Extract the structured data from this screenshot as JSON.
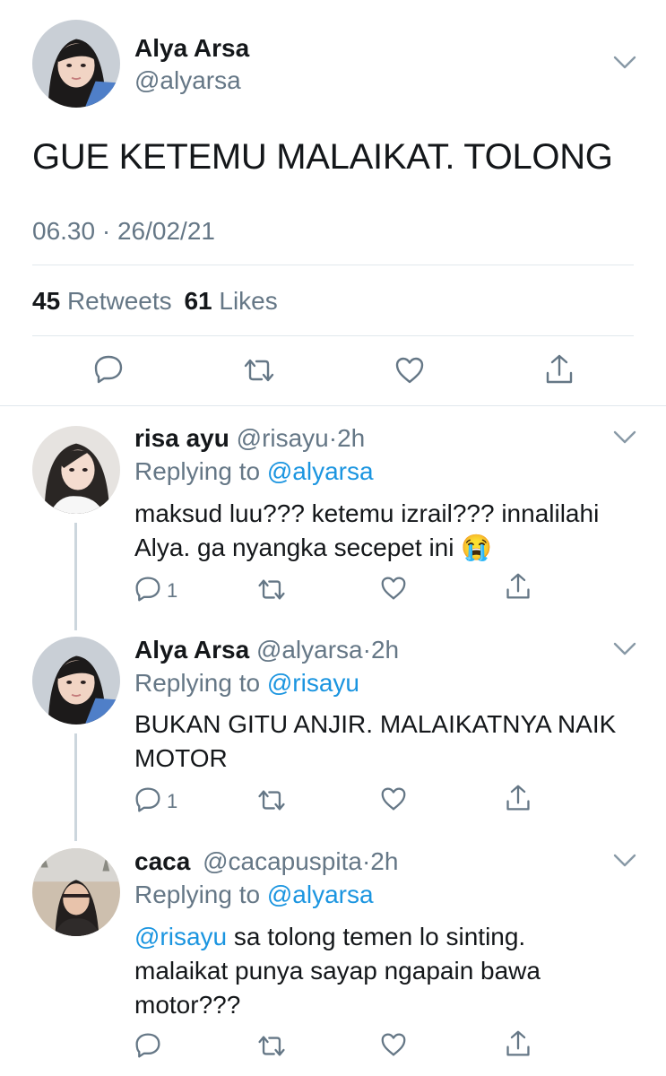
{
  "main_tweet": {
    "author_name": "Alya Arsa",
    "author_handle": "@alyarsa",
    "text": "GUE KETEMU MALAIKAT. TOLONG",
    "time": "06.30",
    "separator": "·",
    "date": "26/02/21",
    "retweets_count": "45",
    "retweets_label": "Retweets",
    "likes_count": "61",
    "likes_label": "Likes"
  },
  "replies": [
    {
      "name": "risa ayu",
      "handle": "@risayu",
      "dot": "·",
      "time": "2h",
      "replying_prefix": "Replying to",
      "replying_to": "@alyarsa",
      "text_line1": "maksud luu??? ketemu izrail??? innalilahi",
      "text_line2": "Alya. ga nyangka secepet ini",
      "emoji": "😭",
      "reply_count": "1"
    },
    {
      "name": "Alya Arsa",
      "handle": "@alyarsa",
      "dot": "·",
      "time": "2h",
      "replying_prefix": "Replying to",
      "replying_to": "@risayu",
      "text_line1": "BUKAN GITU ANJIR. MALAIKATNYA NAIK",
      "text_line2": "MOTOR",
      "reply_count": "1"
    },
    {
      "name": "caca",
      "handle": "@cacapuspita",
      "dot": "·",
      "time": "2h",
      "replying_prefix": "Replying to",
      "replying_to": "@alyarsa",
      "mention": "@risayu",
      "text_line1_rest": "sa tolong temen lo sinting.",
      "text_line2": "malaikat punya sayap ngapain bawa",
      "text_line3": "motor???"
    }
  ],
  "icons": [
    "chevron-down-icon",
    "reply-icon",
    "retweet-icon",
    "like-icon",
    "share-icon"
  ],
  "colors": {
    "link": "#1b95e0",
    "secondary_text": "#657786",
    "divider": "#e1e8ed",
    "icon": "#657786"
  }
}
